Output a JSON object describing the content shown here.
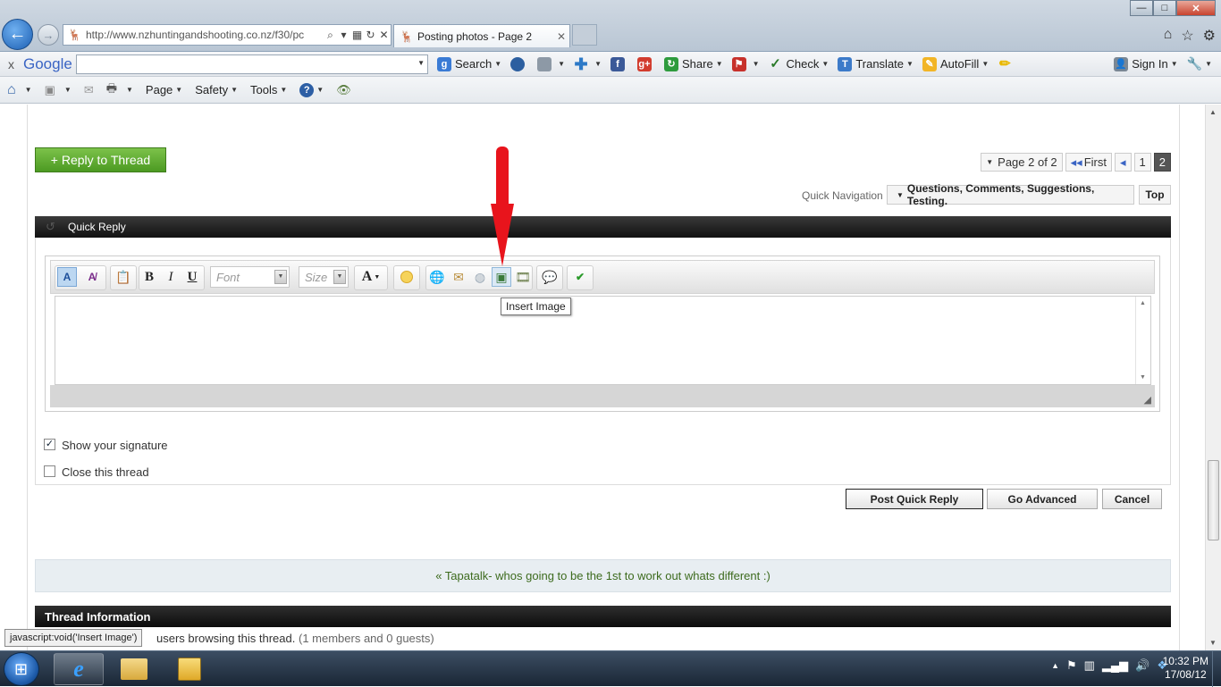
{
  "browser": {
    "url": "http://www.nzhuntingandshooting.co.nz/f30/pc",
    "tab_title": "Posting photos - Page 2",
    "window_controls": {
      "minimize": "—",
      "maximize": "□",
      "close": "✕"
    }
  },
  "google_bar": {
    "close": "x",
    "logo": "Google",
    "items": [
      "Search",
      "Share",
      "Check",
      "Translate",
      "AutoFill",
      "Sign In"
    ]
  },
  "command_bar": {
    "items": [
      "Page",
      "Safety",
      "Tools"
    ]
  },
  "forum": {
    "reply_button": "+ Reply to Thread",
    "pagination": {
      "label": "Page 2 of 2",
      "first": "First",
      "prev": "◂",
      "page1": "1",
      "page2": "2"
    },
    "quick_nav_label": "Quick Navigation",
    "quick_nav_value": "Questions, Comments, Suggestions, Testing.",
    "top_button": "Top",
    "quick_reply_title": "Quick Reply",
    "editor": {
      "font_placeholder": "Font",
      "size_placeholder": "Size",
      "tooltip": "Insert Image",
      "toolbar_icons": [
        "switch-editor-mode-icon",
        "remove-format-icon",
        "paste-icon",
        "bold-icon",
        "italic-icon",
        "underline-icon",
        "font-color-icon",
        "smiley-icon",
        "link-icon",
        "email-icon",
        "unlink-icon",
        "insert-image-icon",
        "insert-video-icon",
        "quote-icon",
        "spellcheck-icon"
      ]
    },
    "show_signature": {
      "label": "Show your signature",
      "checked": true
    },
    "close_thread": {
      "label": "Close this thread",
      "checked": false
    },
    "buttons": {
      "post": "Post Quick Reply",
      "advanced": "Go Advanced",
      "cancel": "Cancel"
    },
    "prev_thread": "« Tapatalk- whos going to be the 1st to work out whats different :)",
    "thread_info_title": "Thread Information",
    "users_text": "users browsing this thread.",
    "users_count": "(1 members and 0 guests)"
  },
  "status_bar": "javascript:void('Insert Image')",
  "taskbar": {
    "clock_time": "10:32 PM",
    "clock_date": "17/08/12"
  },
  "colors": {
    "reply_green": "#5aa62c",
    "annotation_arrow": "#e8141c",
    "header_dark": "#1e1e1e",
    "link_green": "#3d6b1e"
  }
}
